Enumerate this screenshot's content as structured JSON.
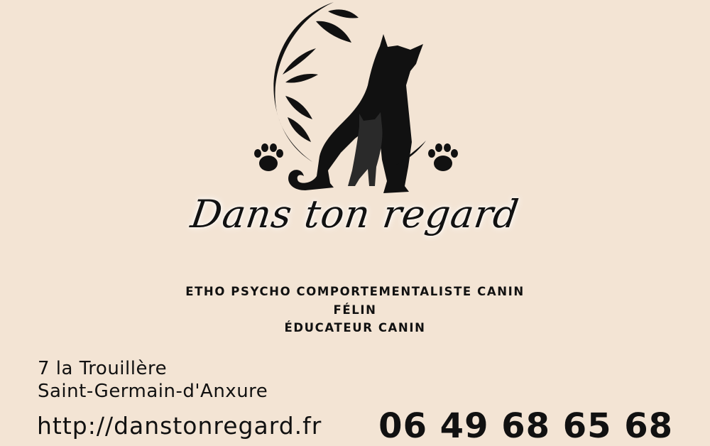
{
  "brand": {
    "name": "Dans ton regard"
  },
  "roles": [
    "ETHO PSYCHO COMPORTEMENTALISTE CANIN",
    "FÉLIN",
    "ÉDUCATEUR CANIN"
  ],
  "address": {
    "line1": "7 la Trouillère",
    "line2": "Saint-Germain-d'Anxure"
  },
  "contact": {
    "website": "http://danstonregard.fr",
    "phone": "06 49 68 65 68"
  },
  "colors": {
    "background": "#f3e4d4",
    "ink": "#111111"
  },
  "icons": [
    "dog-cat-silhouette-icon",
    "leaf-branch-icon",
    "paw-print-icon"
  ]
}
